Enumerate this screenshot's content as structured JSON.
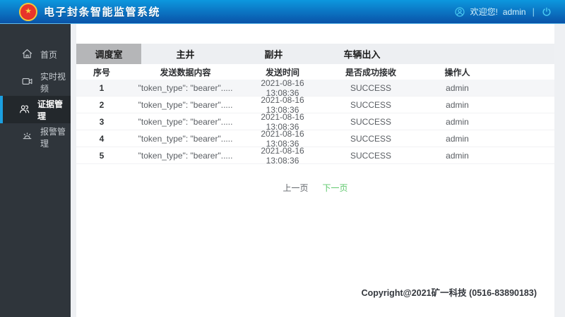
{
  "colors": {
    "header_gradient_top": "#0c97de",
    "header_gradient_bottom": "#0a53a8",
    "sidebar_bg": "#2f353b",
    "sidebar_active_bg": "#23282c",
    "sidebar_active_bar": "#1b9fe0",
    "page_bg": "#eef0f3",
    "tabbar_bg": "#edeff2",
    "tab_active_bg": "#b5b6b8",
    "row_shaded_bg": "#f5f6f8",
    "pager_next_green": "#5fc86d",
    "topbar_icon_cyan": "#49c9f0"
  },
  "header": {
    "title": "电子封条智能监管系统",
    "logo_icon": "national-emblem",
    "welcome_text": "欢迎您!",
    "username": "admin",
    "divider": "|"
  },
  "sidebar": {
    "items": [
      {
        "label": "首页",
        "icon": "home-icon",
        "active": false
      },
      {
        "label": "实时视频",
        "icon": "video-icon",
        "active": false
      },
      {
        "label": "证据管理",
        "icon": "users-icon",
        "active": true
      },
      {
        "label": "报警管理",
        "icon": "alarm-icon",
        "active": false
      }
    ]
  },
  "tabs": [
    {
      "label": "调度室",
      "active": true
    },
    {
      "label": "主井",
      "active": false
    },
    {
      "label": "副井",
      "active": false
    },
    {
      "label": "车辆出入",
      "active": false
    }
  ],
  "table": {
    "columns": [
      "序号",
      "发送数据内容",
      "发送时间",
      "是否成功接收",
      "操作人"
    ],
    "rows": [
      {
        "no": "1",
        "content": "\"token_type\": \"bearer\".....",
        "time": "2021-08-16 13:08:36",
        "status": "SUCCESS",
        "operator": "admin"
      },
      {
        "no": "2",
        "content": "\"token_type\": \"bearer\".....",
        "time": "2021-08-16 13:08:36",
        "status": "SUCCESS",
        "operator": "admin"
      },
      {
        "no": "3",
        "content": "\"token_type\": \"bearer\".....",
        "time": "2021-08-16 13:08:36",
        "status": "SUCCESS",
        "operator": "admin"
      },
      {
        "no": "4",
        "content": "\"token_type\": \"bearer\".....",
        "time": "2021-08-16 13:08:36",
        "status": "SUCCESS",
        "operator": "admin"
      },
      {
        "no": "5",
        "content": "\"token_type\": \"bearer\".....",
        "time": "2021-08-16 13:08:36",
        "status": "SUCCESS",
        "operator": "admin"
      }
    ]
  },
  "pagination": {
    "prev": "上一页",
    "next": "下一页"
  },
  "footer": {
    "copyright": "Copyright@2021矿一科技（0516-83890183）",
    "copyright_plain": "Copyright@2021矿一科技 (0516-83890183)"
  }
}
